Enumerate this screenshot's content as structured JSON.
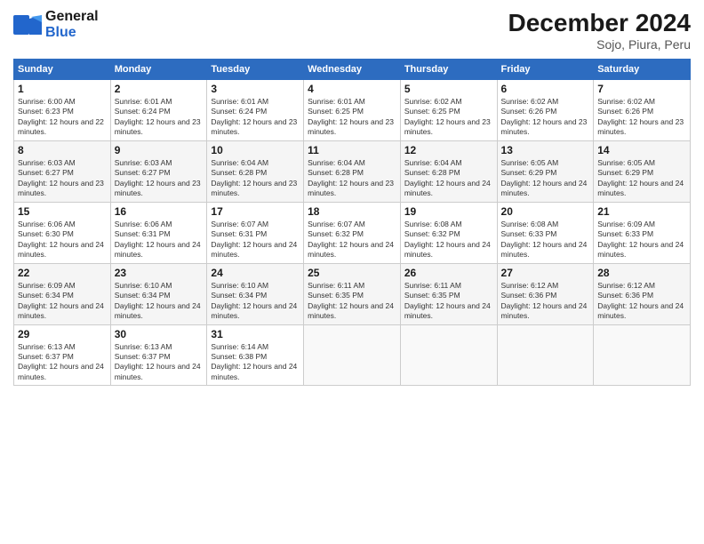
{
  "logo": {
    "line1": "General",
    "line2": "Blue"
  },
  "title": "December 2024",
  "subtitle": "Sojo, Piura, Peru",
  "days_header": [
    "Sunday",
    "Monday",
    "Tuesday",
    "Wednesday",
    "Thursday",
    "Friday",
    "Saturday"
  ],
  "weeks": [
    [
      {
        "day": "1",
        "sunrise": "6:00 AM",
        "sunset": "6:23 PM",
        "daylight": "12 hours and 22 minutes."
      },
      {
        "day": "2",
        "sunrise": "6:01 AM",
        "sunset": "6:24 PM",
        "daylight": "12 hours and 23 minutes."
      },
      {
        "day": "3",
        "sunrise": "6:01 AM",
        "sunset": "6:24 PM",
        "daylight": "12 hours and 23 minutes."
      },
      {
        "day": "4",
        "sunrise": "6:01 AM",
        "sunset": "6:25 PM",
        "daylight": "12 hours and 23 minutes."
      },
      {
        "day": "5",
        "sunrise": "6:02 AM",
        "sunset": "6:25 PM",
        "daylight": "12 hours and 23 minutes."
      },
      {
        "day": "6",
        "sunrise": "6:02 AM",
        "sunset": "6:26 PM",
        "daylight": "12 hours and 23 minutes."
      },
      {
        "day": "7",
        "sunrise": "6:02 AM",
        "sunset": "6:26 PM",
        "daylight": "12 hours and 23 minutes."
      }
    ],
    [
      {
        "day": "8",
        "sunrise": "6:03 AM",
        "sunset": "6:27 PM",
        "daylight": "12 hours and 23 minutes."
      },
      {
        "day": "9",
        "sunrise": "6:03 AM",
        "sunset": "6:27 PM",
        "daylight": "12 hours and 23 minutes."
      },
      {
        "day": "10",
        "sunrise": "6:04 AM",
        "sunset": "6:28 PM",
        "daylight": "12 hours and 23 minutes."
      },
      {
        "day": "11",
        "sunrise": "6:04 AM",
        "sunset": "6:28 PM",
        "daylight": "12 hours and 23 minutes."
      },
      {
        "day": "12",
        "sunrise": "6:04 AM",
        "sunset": "6:28 PM",
        "daylight": "12 hours and 24 minutes."
      },
      {
        "day": "13",
        "sunrise": "6:05 AM",
        "sunset": "6:29 PM",
        "daylight": "12 hours and 24 minutes."
      },
      {
        "day": "14",
        "sunrise": "6:05 AM",
        "sunset": "6:29 PM",
        "daylight": "12 hours and 24 minutes."
      }
    ],
    [
      {
        "day": "15",
        "sunrise": "6:06 AM",
        "sunset": "6:30 PM",
        "daylight": "12 hours and 24 minutes."
      },
      {
        "day": "16",
        "sunrise": "6:06 AM",
        "sunset": "6:31 PM",
        "daylight": "12 hours and 24 minutes."
      },
      {
        "day": "17",
        "sunrise": "6:07 AM",
        "sunset": "6:31 PM",
        "daylight": "12 hours and 24 minutes."
      },
      {
        "day": "18",
        "sunrise": "6:07 AM",
        "sunset": "6:32 PM",
        "daylight": "12 hours and 24 minutes."
      },
      {
        "day": "19",
        "sunrise": "6:08 AM",
        "sunset": "6:32 PM",
        "daylight": "12 hours and 24 minutes."
      },
      {
        "day": "20",
        "sunrise": "6:08 AM",
        "sunset": "6:33 PM",
        "daylight": "12 hours and 24 minutes."
      },
      {
        "day": "21",
        "sunrise": "6:09 AM",
        "sunset": "6:33 PM",
        "daylight": "12 hours and 24 minutes."
      }
    ],
    [
      {
        "day": "22",
        "sunrise": "6:09 AM",
        "sunset": "6:34 PM",
        "daylight": "12 hours and 24 minutes."
      },
      {
        "day": "23",
        "sunrise": "6:10 AM",
        "sunset": "6:34 PM",
        "daylight": "12 hours and 24 minutes."
      },
      {
        "day": "24",
        "sunrise": "6:10 AM",
        "sunset": "6:34 PM",
        "daylight": "12 hours and 24 minutes."
      },
      {
        "day": "25",
        "sunrise": "6:11 AM",
        "sunset": "6:35 PM",
        "daylight": "12 hours and 24 minutes."
      },
      {
        "day": "26",
        "sunrise": "6:11 AM",
        "sunset": "6:35 PM",
        "daylight": "12 hours and 24 minutes."
      },
      {
        "day": "27",
        "sunrise": "6:12 AM",
        "sunset": "6:36 PM",
        "daylight": "12 hours and 24 minutes."
      },
      {
        "day": "28",
        "sunrise": "6:12 AM",
        "sunset": "6:36 PM",
        "daylight": "12 hours and 24 minutes."
      }
    ],
    [
      {
        "day": "29",
        "sunrise": "6:13 AM",
        "sunset": "6:37 PM",
        "daylight": "12 hours and 24 minutes."
      },
      {
        "day": "30",
        "sunrise": "6:13 AM",
        "sunset": "6:37 PM",
        "daylight": "12 hours and 24 minutes."
      },
      {
        "day": "31",
        "sunrise": "6:14 AM",
        "sunset": "6:38 PM",
        "daylight": "12 hours and 24 minutes."
      },
      null,
      null,
      null,
      null
    ]
  ]
}
